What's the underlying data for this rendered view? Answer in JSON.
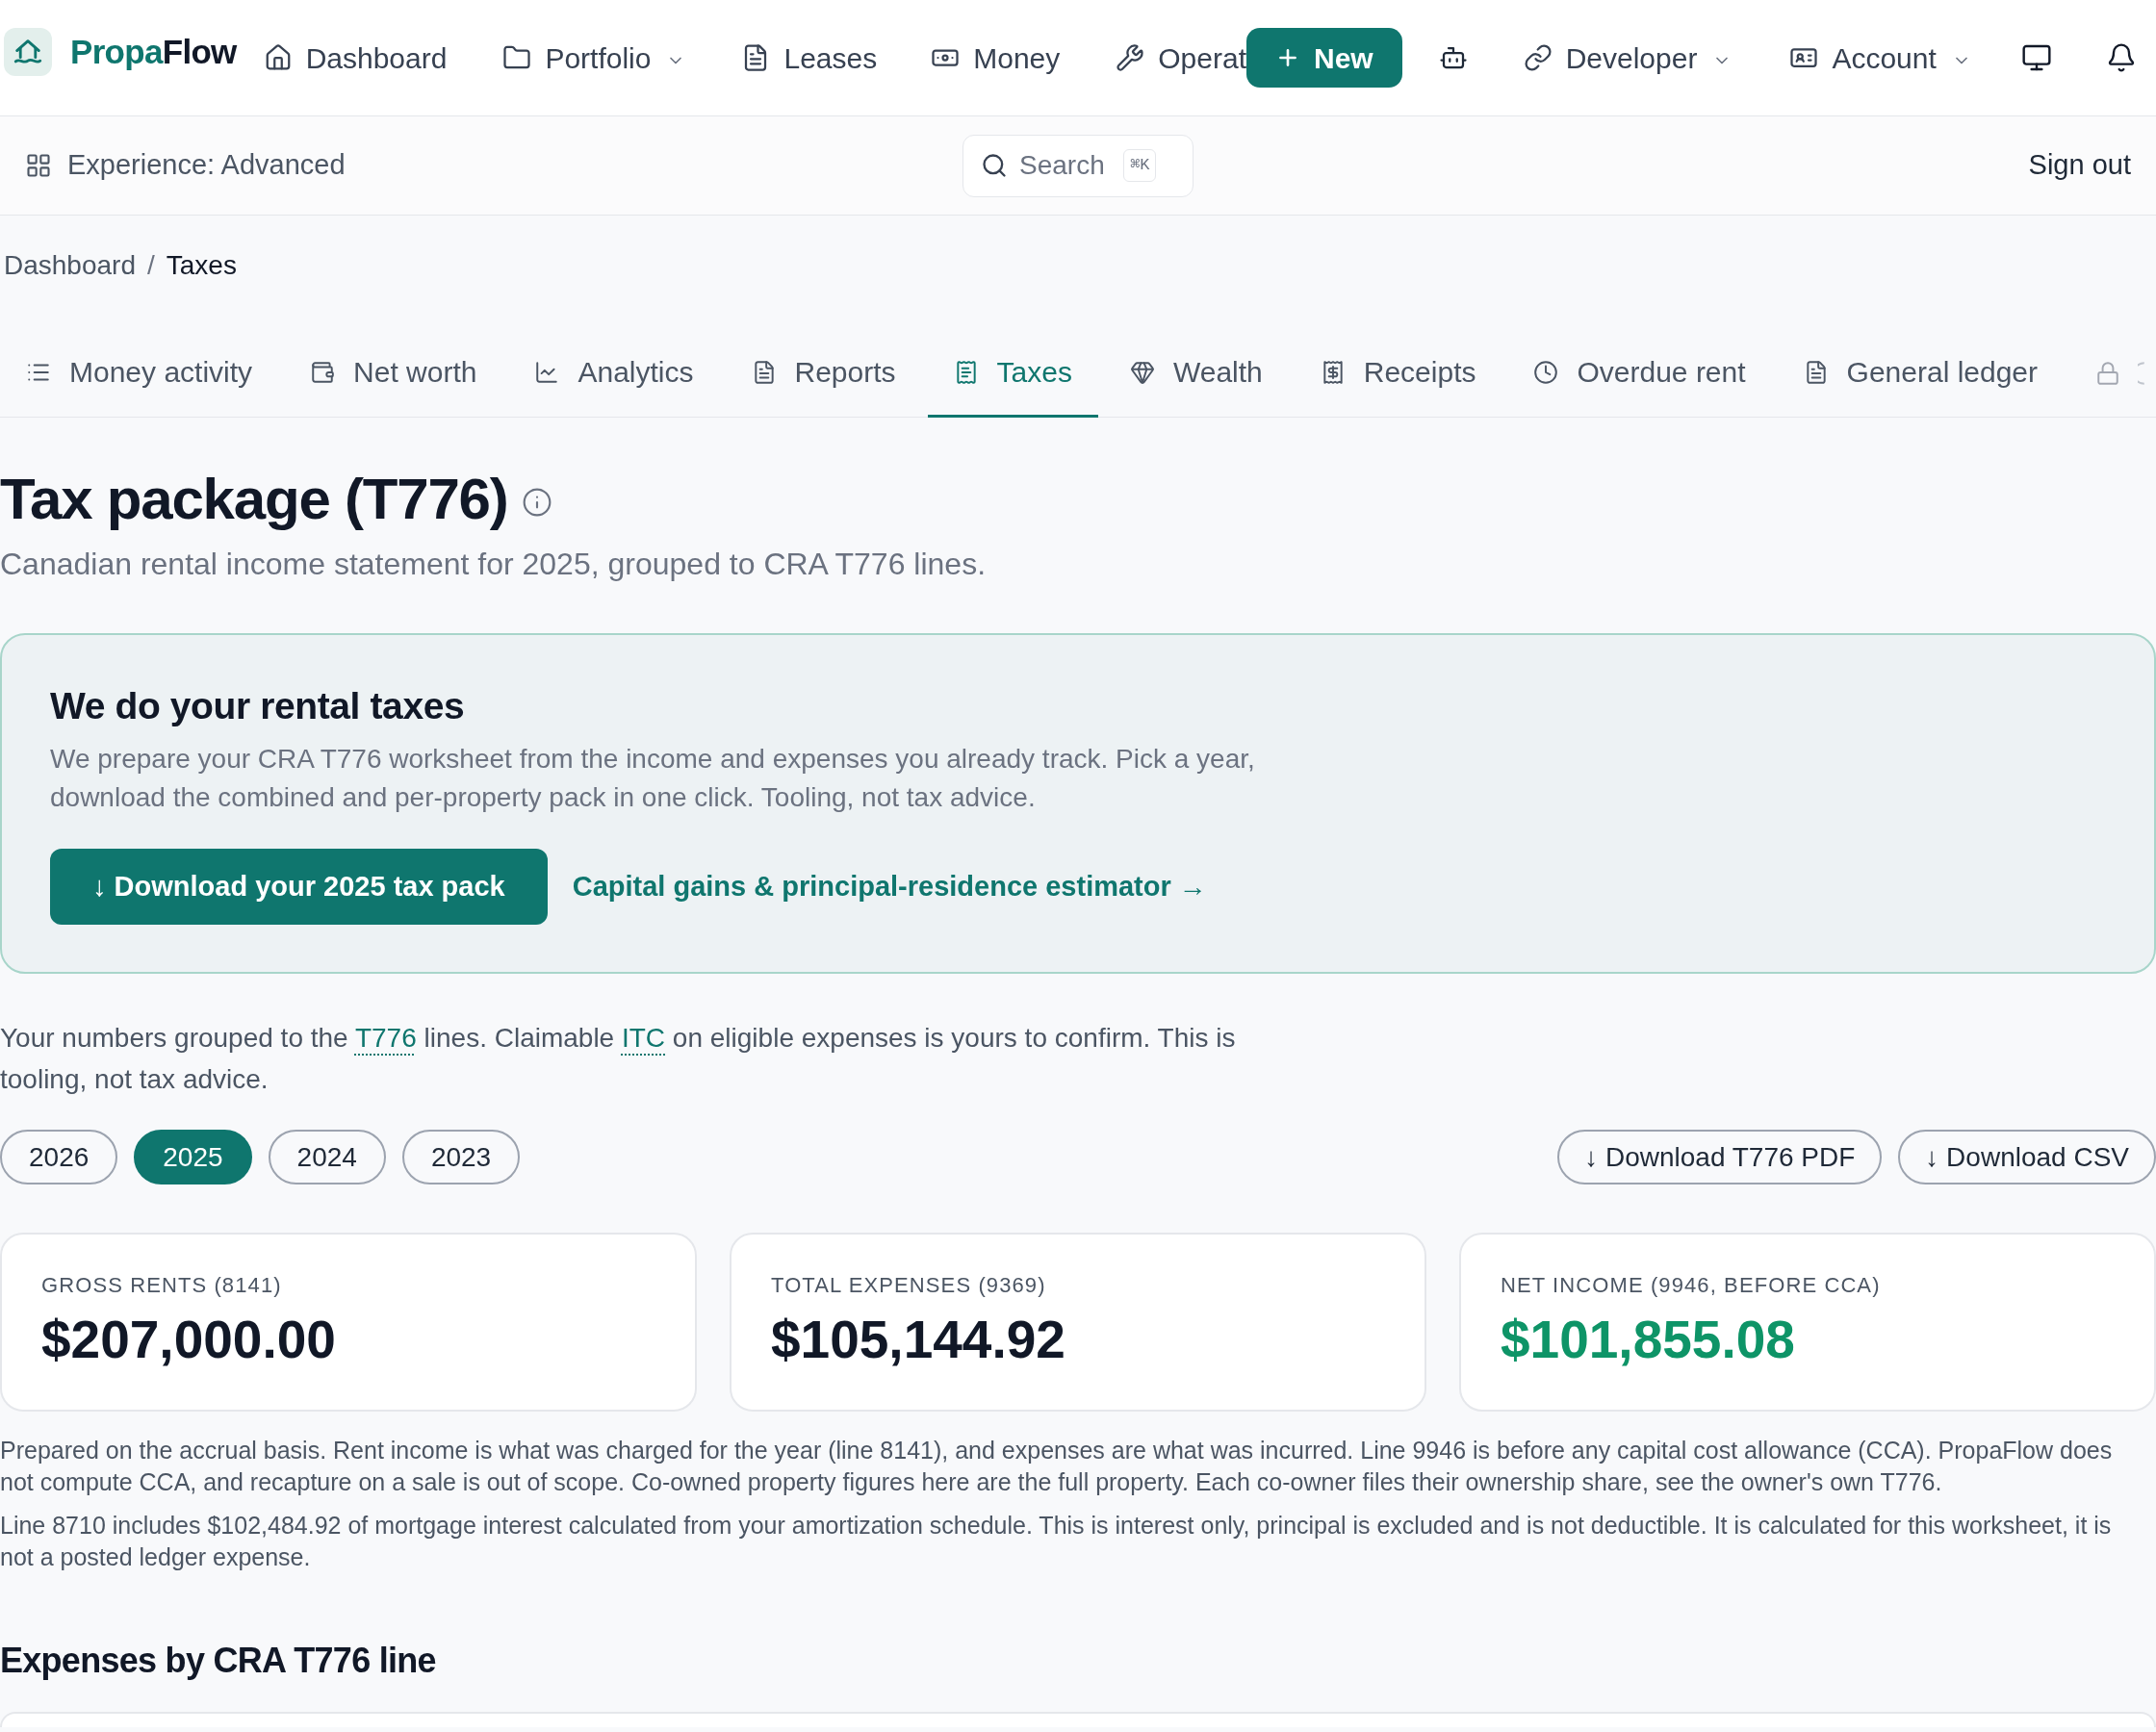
{
  "header": {
    "brand": {
      "accent": "Propa",
      "rest": "Flow"
    },
    "nav_links": [
      {
        "label": "Dashboard",
        "dropdown": false
      },
      {
        "label": "Portfolio",
        "dropdown": true
      },
      {
        "label": "Leases",
        "dropdown": false
      },
      {
        "label": "Money",
        "dropdown": false
      },
      {
        "label": "Operat",
        "dropdown": false
      }
    ],
    "new_button": "New",
    "nav_links_right": [
      {
        "label": "Developer",
        "dropdown": true
      },
      {
        "label": "Account",
        "dropdown": true
      }
    ]
  },
  "subbar": {
    "experience": "Experience: Advanced",
    "search": {
      "placeholder": "Search",
      "shortcut": "⌘K"
    },
    "sign_out": "Sign out"
  },
  "breadcrumb": {
    "separator": "/",
    "items": [
      {
        "label": "Dashboard",
        "current": false
      },
      {
        "label": "Taxes",
        "current": true
      }
    ]
  },
  "tabs": [
    {
      "label": "Money activity",
      "selected": false
    },
    {
      "label": "Net worth",
      "selected": false
    },
    {
      "label": "Analytics",
      "selected": false
    },
    {
      "label": "Reports",
      "selected": false
    },
    {
      "label": "Taxes",
      "selected": true
    },
    {
      "label": "Wealth",
      "selected": false
    },
    {
      "label": "Receipts",
      "selected": false
    },
    {
      "label": "Overdue rent",
      "selected": false
    },
    {
      "label": "General ledger",
      "selected": false
    }
  ],
  "page": {
    "title": "Tax package (T776)",
    "subtitle": "Canadian rental income statement for 2025, grouped to CRA T776 lines."
  },
  "banner": {
    "title": "We do your rental taxes",
    "text": "We prepare your CRA T776 worksheet from the income and expenses you already track. Pick a year, download the combined and per-property pack in one click. Tooling, not tax advice.",
    "button": "↓ Download your 2025 tax pack",
    "link": "Capital gains & principal-residence estimator →"
  },
  "intro": [
    {
      "text": "Your numbers grouped to the ",
      "kind": "plain"
    },
    {
      "text": "T776",
      "kind": "term"
    },
    {
      "text": " lines. Claimable ",
      "kind": "plain"
    },
    {
      "text": "ITC",
      "kind": "term"
    },
    {
      "text": " on eligible expenses is yours to confirm. This is tooling, not tax advice.",
      "kind": "plain"
    }
  ],
  "years": [
    {
      "label": "2026",
      "selected": false
    },
    {
      "label": "2025",
      "selected": true
    },
    {
      "label": "2024",
      "selected": false
    },
    {
      "label": "2023",
      "selected": false
    }
  ],
  "export_buttons": [
    "↓ Download T776 PDF",
    "↓ Download CSV"
  ],
  "stats": [
    {
      "label": "GROSS RENTS (8141)",
      "value": "$207,000.00",
      "highlighted": false
    },
    {
      "label": "TOTAL EXPENSES (9369)",
      "value": "$105,144.92",
      "highlighted": false
    },
    {
      "label": "NET INCOME (9946, BEFORE CCA)",
      "value": "$101,855.08",
      "highlighted": true
    }
  ],
  "notes": [
    "Prepared on the accrual basis. Rent income is what was charged for the year (line 8141), and expenses are what was incurred. Line 9946 is before any capital cost allowance (CCA). PropaFlow does not compute CCA, and recapture on a sale is out of scope. Co-owned property figures here are the full property. Each co-owner files their ownership share, see the owner's own T776.",
    "Line 8710 includes $102,484.92 of mortgage interest calculated from your amortization schedule. This is interest only, principal is excluded and is not deductible. It is calculated for this worksheet, it is not a posted ledger expense."
  ],
  "section_title": "Expenses by CRA T776 line"
}
